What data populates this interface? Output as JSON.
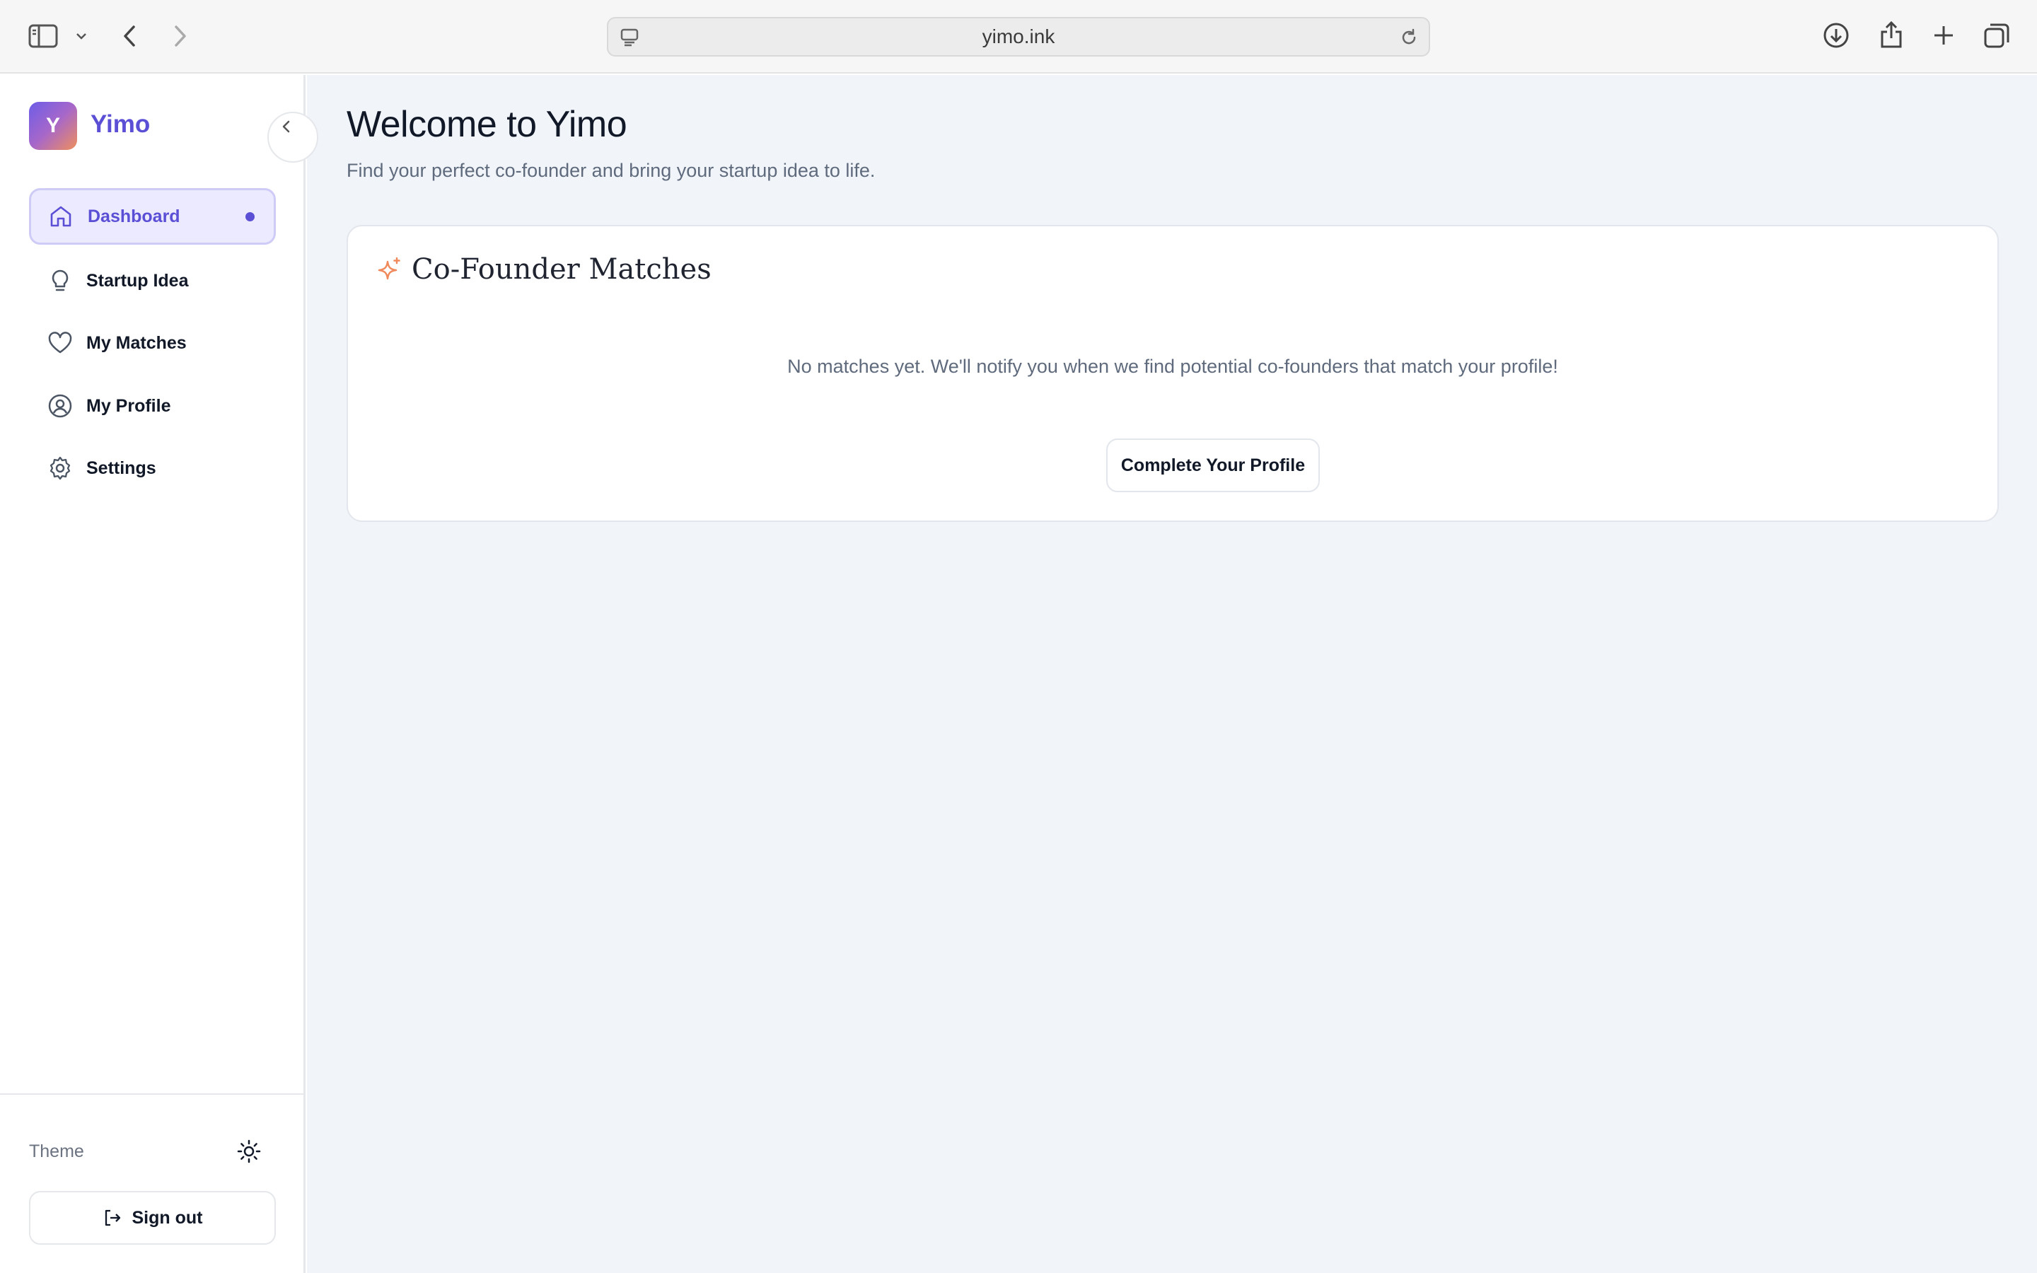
{
  "browser": {
    "url": "yimo.ink",
    "icons": [
      "sidebar-toggle-icon",
      "chevron-down-icon",
      "back-arrow-icon",
      "forward-arrow-icon",
      "site-info-icon",
      "reload-icon",
      "download-icon",
      "share-icon",
      "new-tab-icon",
      "tabs-overview-icon"
    ]
  },
  "sidebar": {
    "logo_letter": "Y",
    "app_name": "Yimo",
    "items": [
      {
        "label": "Dashboard",
        "icon": "home-icon",
        "active": true
      },
      {
        "label": "Startup Idea",
        "icon": "lightbulb-icon"
      },
      {
        "label": "My Matches",
        "icon": "heart-icon"
      },
      {
        "label": "My Profile",
        "icon": "user-circle-icon"
      },
      {
        "label": "Settings",
        "icon": "gear-icon"
      }
    ],
    "theme_label": "Theme",
    "signout_label": "Sign out"
  },
  "main": {
    "title": "Welcome to Yimo",
    "subtitle": "Find your perfect co-founder and bring your startup idea to life.",
    "card": {
      "title": "Co-Founder Matches",
      "icon": "sparkle-icon",
      "empty_text": "No matches yet. We'll notify you when we find potential co-founders that match your profile!",
      "cta_label": "Complete Your Profile"
    }
  },
  "colors": {
    "accent": "#5b4fd6",
    "sparkle": "#f08a5d",
    "main_bg": "#f1f4f9"
  }
}
